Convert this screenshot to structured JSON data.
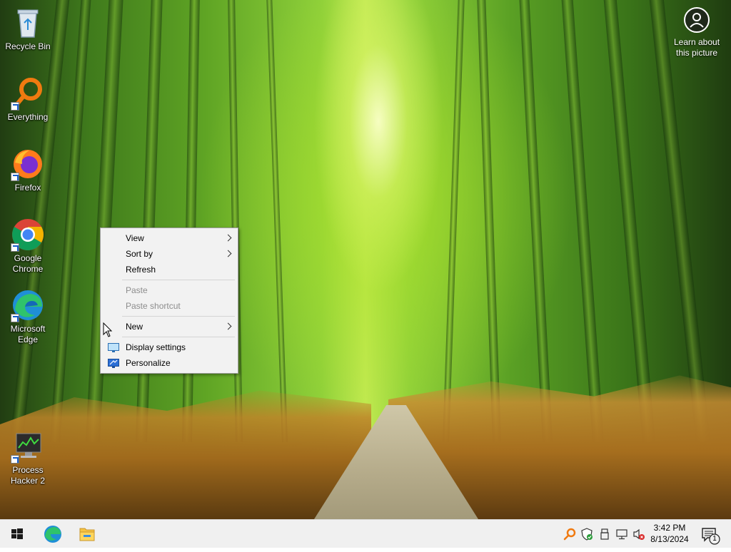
{
  "desktop": {
    "icons": [
      {
        "label": "Recycle Bin"
      },
      {
        "label": "Everything"
      },
      {
        "label": "Firefox"
      },
      {
        "label": "Google Chrome"
      },
      {
        "label": "Microsoft Edge"
      },
      {
        "label": "Process Hacker 2"
      }
    ],
    "learn_about_picture": "Learn about this picture"
  },
  "context_menu": {
    "items": [
      {
        "label": "View",
        "submenu": true,
        "enabled": true
      },
      {
        "label": "Sort by",
        "submenu": true,
        "enabled": true
      },
      {
        "label": "Refresh",
        "submenu": false,
        "enabled": true
      },
      {
        "label": "Paste",
        "submenu": false,
        "enabled": false
      },
      {
        "label": "Paste shortcut",
        "submenu": false,
        "enabled": false
      },
      {
        "label": "New",
        "submenu": true,
        "enabled": true
      },
      {
        "label": "Display settings",
        "submenu": false,
        "enabled": true,
        "icon": "display-settings-icon"
      },
      {
        "label": "Personalize",
        "submenu": false,
        "enabled": true,
        "icon": "personalize-icon"
      }
    ]
  },
  "taskbar": {
    "pinned": [
      "start-button",
      "edge-icon",
      "file-explorer-icon"
    ],
    "tray_icons": [
      "everything-tray-icon",
      "security-shield-icon",
      "usb-device-icon",
      "network-icon",
      "volume-muted-icon"
    ],
    "clock": {
      "time": "3:42 PM",
      "date": "8/13/2024"
    },
    "notifications": {
      "count": "1"
    }
  },
  "colors": {
    "taskbar_bg": "#f0f0f0",
    "menu_bg": "#f2f2f2",
    "disabled_text": "#8d8d8d"
  }
}
